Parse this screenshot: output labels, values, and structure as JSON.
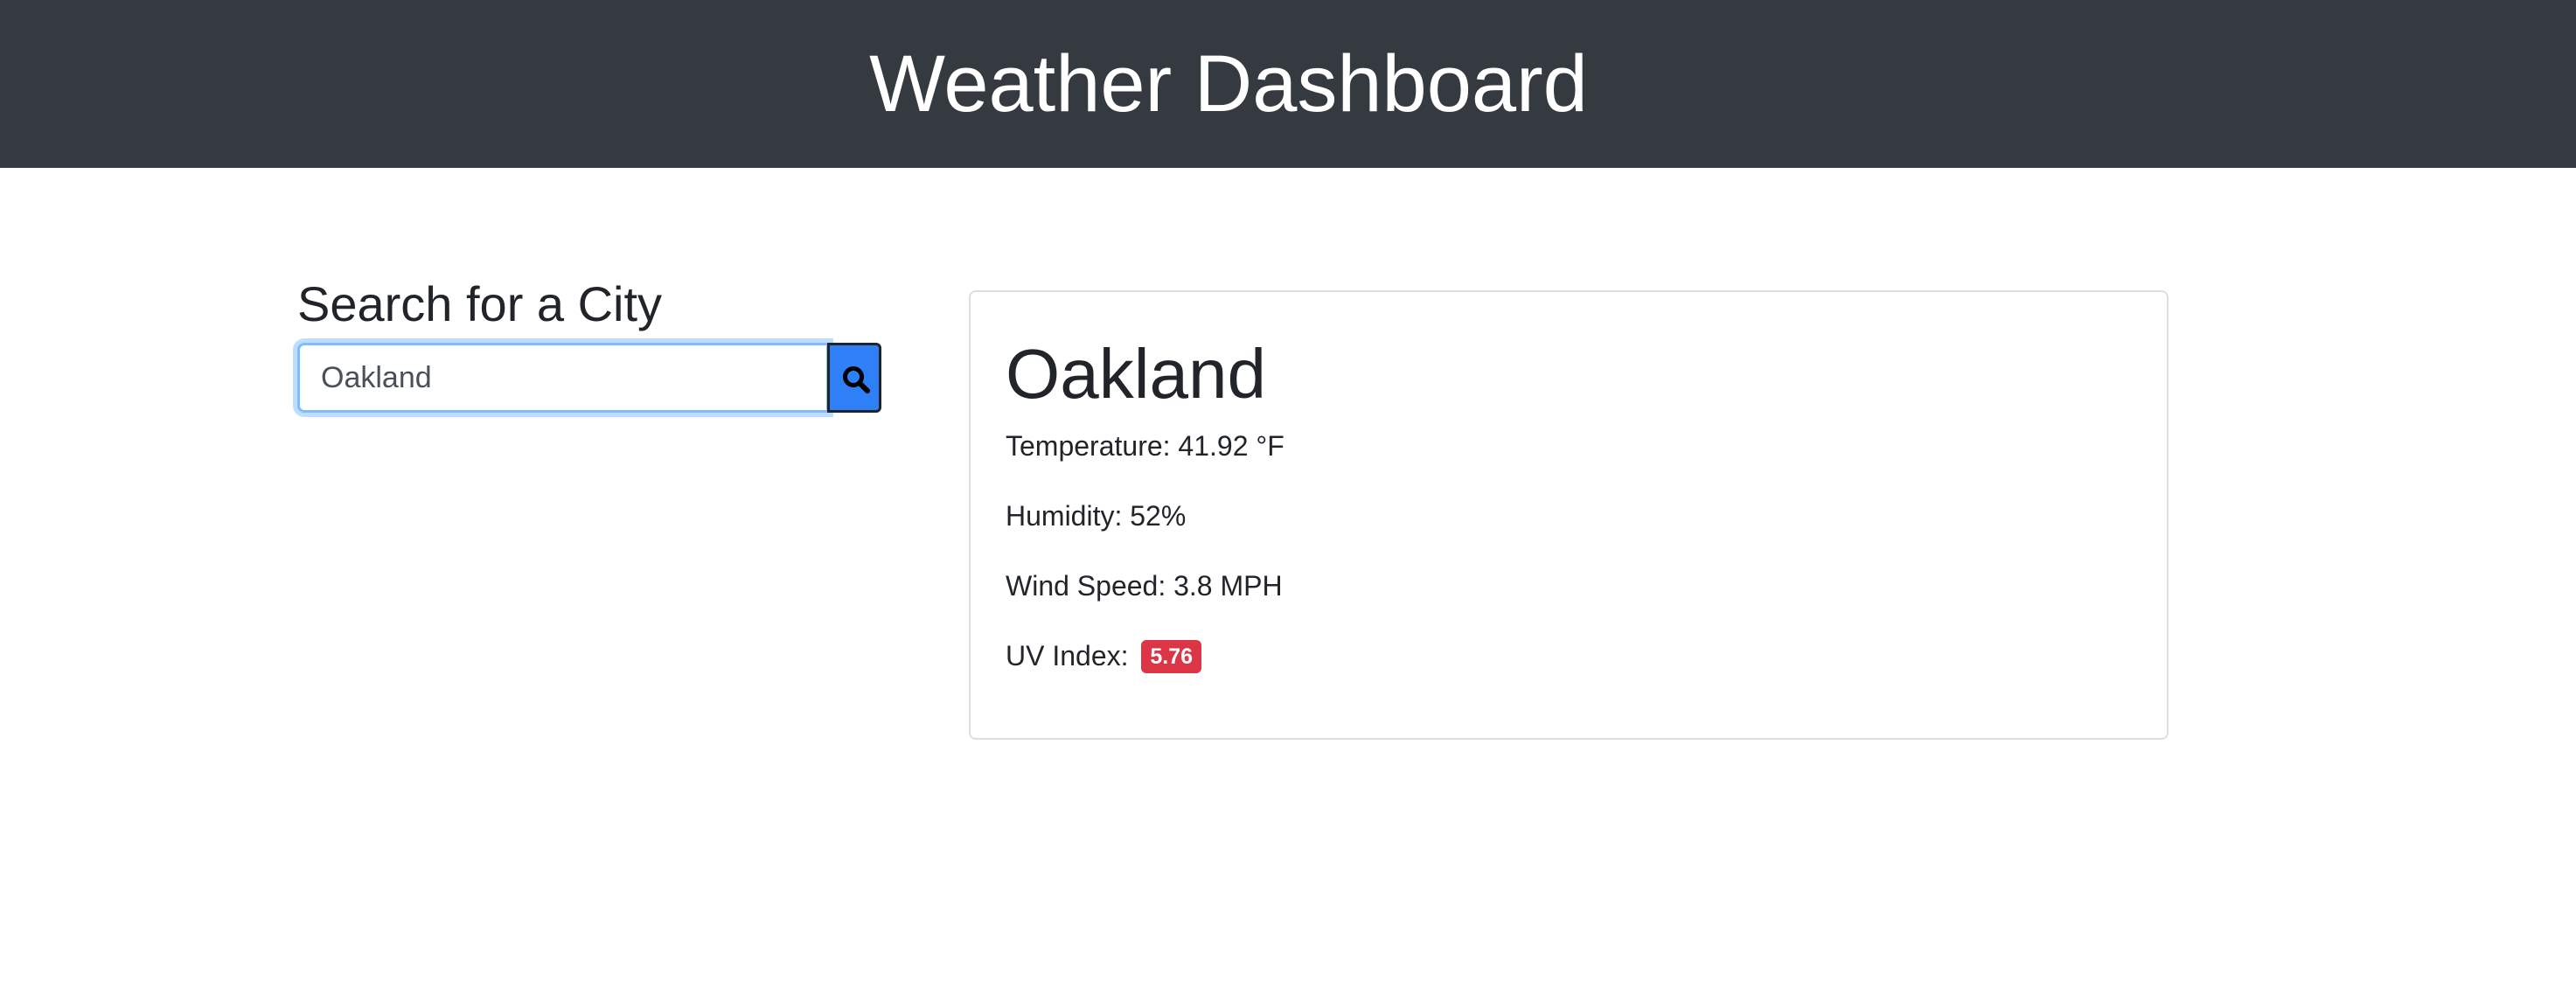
{
  "header": {
    "title": "Weather Dashboard"
  },
  "search": {
    "heading": "Search for a City",
    "value": "Oakland",
    "button_icon": "search-icon"
  },
  "current": {
    "city": "Oakland",
    "temperature_label": "Temperature:",
    "temperature_value": "41.92 °F",
    "humidity_label": "Humidity:",
    "humidity_value": "52%",
    "wind_label": "Wind Speed:",
    "wind_value": "3.8 MPH",
    "uv_label": "UV Index:",
    "uv_value": "5.76"
  },
  "colors": {
    "navbar": "#343a40",
    "search_button": "#2f80f6",
    "uv_badge": "#dc3545",
    "focus_border": "#80bdff"
  }
}
